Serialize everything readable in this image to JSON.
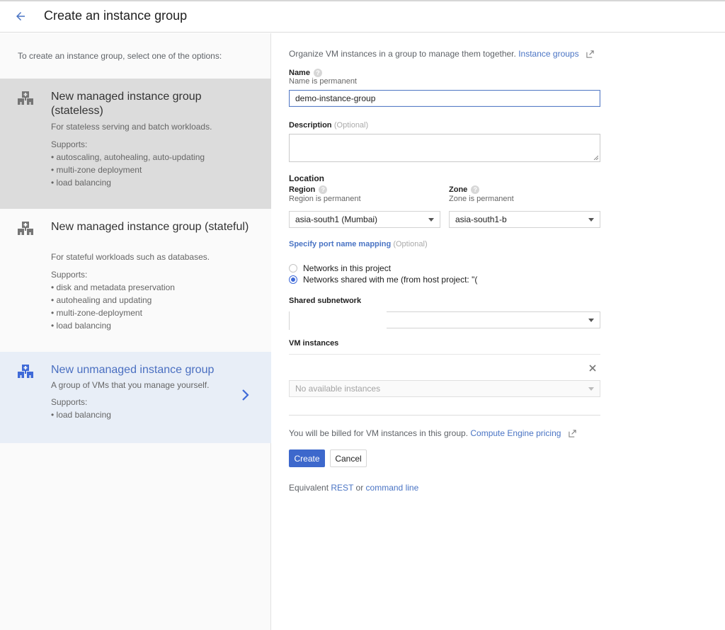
{
  "header": {
    "back_icon": "arrow-left-icon",
    "title": "Create an instance group"
  },
  "left_panel": {
    "intro": "To create an instance group, select one of the options:",
    "options": [
      {
        "icon": "instance-group-icon",
        "title": "New managed instance group (stateless)",
        "description": "For stateless serving and batch workloads.",
        "supports_label": "Supports:",
        "supports": [
          "autoscaling, autohealing, auto-updating",
          "multi-zone deployment",
          "load balancing"
        ],
        "state": "hover"
      },
      {
        "icon": "instance-group-icon",
        "title": "New managed instance group (stateful)",
        "description": "For stateful workloads such as databases.",
        "supports_label": "Supports:",
        "supports": [
          "disk and metadata preservation",
          "autohealing and updating",
          "multi-zone-deployment",
          "load balancing"
        ],
        "state": "default"
      },
      {
        "icon": "instance-group-icon",
        "title": "New unmanaged instance group",
        "description": "A group of VMs that you manage yourself.",
        "supports_label": "Supports:",
        "supports": [
          "load balancing"
        ],
        "state": "selected",
        "chevron_icon": "chevron-right-icon"
      }
    ]
  },
  "form": {
    "intro": "Organize VM instances in a group to manage them together.",
    "intro_link": "Instance groups",
    "name": {
      "label": "Name",
      "hint": "Name is permanent",
      "value": "demo-instance-group"
    },
    "description": {
      "label": "Description",
      "optional": "(Optional)",
      "value": ""
    },
    "location": {
      "label": "Location",
      "region": {
        "label": "Region",
        "hint": "Region is permanent",
        "value": "asia-south1 (Mumbai)"
      },
      "zone": {
        "label": "Zone",
        "hint": "Zone is permanent",
        "value": "asia-south1-b"
      }
    },
    "port_mapping": {
      "link": "Specify port name mapping",
      "optional": "(Optional)"
    },
    "network": {
      "options": [
        {
          "label": "Networks in this project",
          "checked": false
        },
        {
          "label": "Networks shared with me (from host project: \"(",
          "checked": true
        }
      ]
    },
    "shared_subnetwork": {
      "label": "Shared subnetwork",
      "value": ""
    },
    "vm_instances": {
      "label": "VM instances",
      "placeholder": "No available instances",
      "remove_icon": "close-icon"
    },
    "billing": {
      "text": "You will be billed for VM instances in this group.",
      "link": "Compute Engine pricing"
    },
    "buttons": {
      "create": "Create",
      "cancel": "Cancel"
    },
    "equivalent": {
      "prefix": "Equivalent",
      "rest": "REST",
      "or": "or",
      "command_line": "command line"
    }
  },
  "colors": {
    "accent": "#3d68cc",
    "link": "#4a74c4",
    "selected_bg": "#e8eef7",
    "hover_bg": "#dcdcdc"
  }
}
